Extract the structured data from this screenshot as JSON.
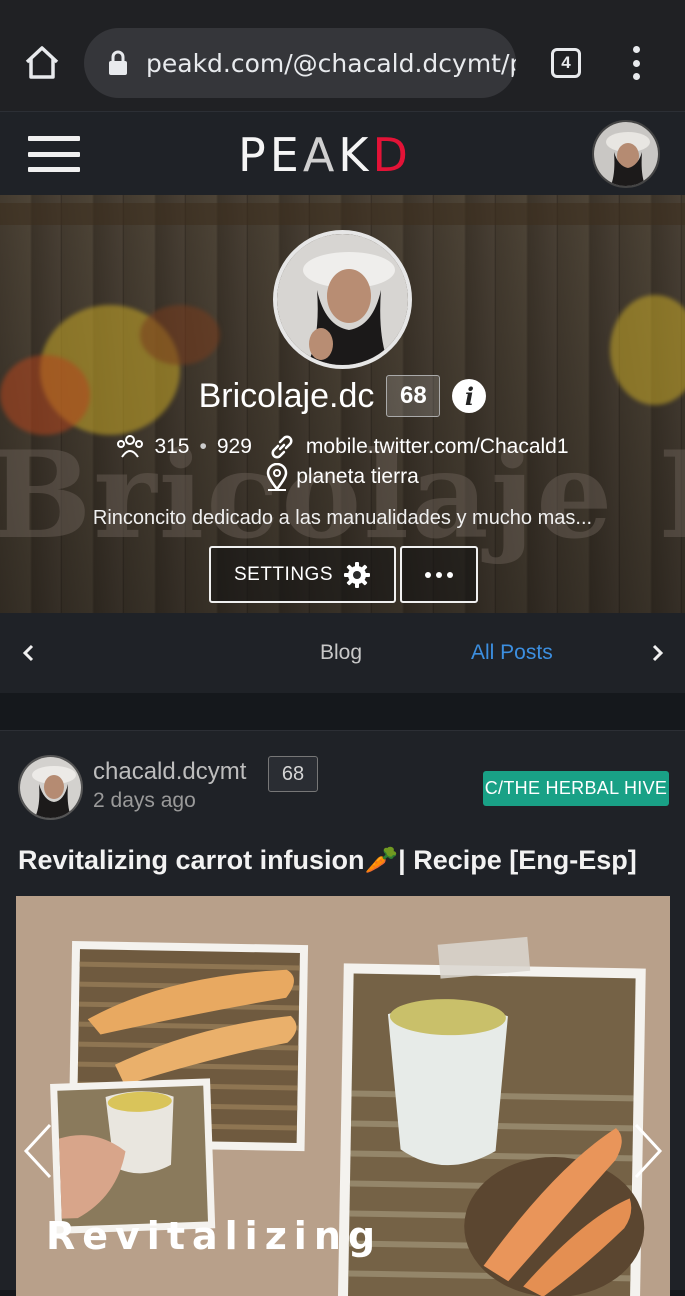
{
  "browser": {
    "url": "peakd.com/@chacald.dcymt/po",
    "tab_count": "4"
  },
  "header": {
    "logo_text_left": "PE",
    "logo_text_mid": "A",
    "logo_text_k": "K",
    "logo_text_d": "D"
  },
  "profile": {
    "name": "Bricolaje.dc",
    "reputation": "68",
    "followers": "315",
    "following": "929",
    "website": "mobile.twitter.com/Chacald1",
    "location": "planeta tierra",
    "about": "Rinconcito dedicado a las manualidades y mucho mas...",
    "banner_text": "Bricolaje Dc",
    "settings_label": "SETTINGS",
    "stat_separator": "•"
  },
  "tabs": {
    "items": [
      {
        "label": "Blog"
      },
      {
        "label": "All Posts"
      }
    ],
    "active": "All Posts"
  },
  "post": {
    "author": "chacald.dcymt",
    "reputation": "68",
    "time": "2 days ago",
    "community": "C/THE HERBAL HIVE",
    "title": "Revitalizing carrot infusion🥕| Recipe [Eng-Esp]",
    "image_caption": "Revitalizing"
  },
  "colors": {
    "accent_blue": "#3c8fe0",
    "community_teal": "#19a186",
    "logo_red": "#e31337"
  }
}
